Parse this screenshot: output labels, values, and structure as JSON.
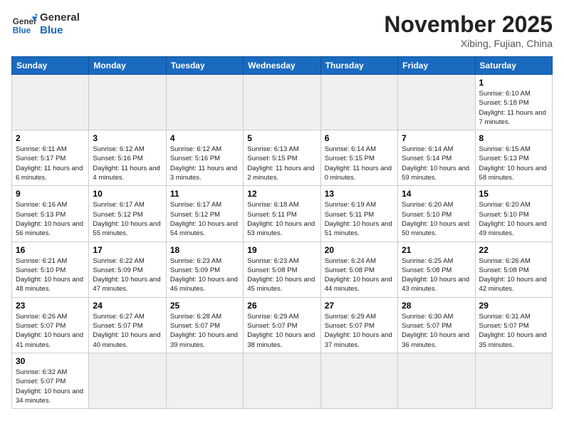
{
  "header": {
    "logo_general": "General",
    "logo_blue": "Blue",
    "month_title": "November 2025",
    "location": "Xibing, Fujian, China"
  },
  "weekdays": [
    "Sunday",
    "Monday",
    "Tuesday",
    "Wednesday",
    "Thursday",
    "Friday",
    "Saturday"
  ],
  "weeks": [
    [
      {
        "day": "",
        "empty": true
      },
      {
        "day": "",
        "empty": true
      },
      {
        "day": "",
        "empty": true
      },
      {
        "day": "",
        "empty": true
      },
      {
        "day": "",
        "empty": true
      },
      {
        "day": "",
        "empty": true
      },
      {
        "day": "1",
        "sunrise": "6:10 AM",
        "sunset": "5:18 PM",
        "daylight": "11 hours and 7 minutes."
      }
    ],
    [
      {
        "day": "2",
        "sunrise": "6:11 AM",
        "sunset": "5:17 PM",
        "daylight": "11 hours and 6 minutes."
      },
      {
        "day": "3",
        "sunrise": "6:12 AM",
        "sunset": "5:16 PM",
        "daylight": "11 hours and 4 minutes."
      },
      {
        "day": "4",
        "sunrise": "6:12 AM",
        "sunset": "5:16 PM",
        "daylight": "11 hours and 3 minutes."
      },
      {
        "day": "5",
        "sunrise": "6:13 AM",
        "sunset": "5:15 PM",
        "daylight": "11 hours and 2 minutes."
      },
      {
        "day": "6",
        "sunrise": "6:14 AM",
        "sunset": "5:15 PM",
        "daylight": "11 hours and 0 minutes."
      },
      {
        "day": "7",
        "sunrise": "6:14 AM",
        "sunset": "5:14 PM",
        "daylight": "10 hours and 59 minutes."
      },
      {
        "day": "8",
        "sunrise": "6:15 AM",
        "sunset": "5:13 PM",
        "daylight": "10 hours and 58 minutes."
      }
    ],
    [
      {
        "day": "9",
        "sunrise": "6:16 AM",
        "sunset": "5:13 PM",
        "daylight": "10 hours and 56 minutes."
      },
      {
        "day": "10",
        "sunrise": "6:17 AM",
        "sunset": "5:12 PM",
        "daylight": "10 hours and 55 minutes."
      },
      {
        "day": "11",
        "sunrise": "6:17 AM",
        "sunset": "5:12 PM",
        "daylight": "10 hours and 54 minutes."
      },
      {
        "day": "12",
        "sunrise": "6:18 AM",
        "sunset": "5:11 PM",
        "daylight": "10 hours and 53 minutes."
      },
      {
        "day": "13",
        "sunrise": "6:19 AM",
        "sunset": "5:11 PM",
        "daylight": "10 hours and 51 minutes."
      },
      {
        "day": "14",
        "sunrise": "6:20 AM",
        "sunset": "5:10 PM",
        "daylight": "10 hours and 50 minutes."
      },
      {
        "day": "15",
        "sunrise": "6:20 AM",
        "sunset": "5:10 PM",
        "daylight": "10 hours and 49 minutes."
      }
    ],
    [
      {
        "day": "16",
        "sunrise": "6:21 AM",
        "sunset": "5:10 PM",
        "daylight": "10 hours and 48 minutes."
      },
      {
        "day": "17",
        "sunrise": "6:22 AM",
        "sunset": "5:09 PM",
        "daylight": "10 hours and 47 minutes."
      },
      {
        "day": "18",
        "sunrise": "6:23 AM",
        "sunset": "5:09 PM",
        "daylight": "10 hours and 46 minutes."
      },
      {
        "day": "19",
        "sunrise": "6:23 AM",
        "sunset": "5:08 PM",
        "daylight": "10 hours and 45 minutes."
      },
      {
        "day": "20",
        "sunrise": "6:24 AM",
        "sunset": "5:08 PM",
        "daylight": "10 hours and 44 minutes."
      },
      {
        "day": "21",
        "sunrise": "6:25 AM",
        "sunset": "5:08 PM",
        "daylight": "10 hours and 43 minutes."
      },
      {
        "day": "22",
        "sunrise": "6:26 AM",
        "sunset": "5:08 PM",
        "daylight": "10 hours and 42 minutes."
      }
    ],
    [
      {
        "day": "23",
        "sunrise": "6:26 AM",
        "sunset": "5:07 PM",
        "daylight": "10 hours and 41 minutes."
      },
      {
        "day": "24",
        "sunrise": "6:27 AM",
        "sunset": "5:07 PM",
        "daylight": "10 hours and 40 minutes."
      },
      {
        "day": "25",
        "sunrise": "6:28 AM",
        "sunset": "5:07 PM",
        "daylight": "10 hours and 39 minutes."
      },
      {
        "day": "26",
        "sunrise": "6:29 AM",
        "sunset": "5:07 PM",
        "daylight": "10 hours and 38 minutes."
      },
      {
        "day": "27",
        "sunrise": "6:29 AM",
        "sunset": "5:07 PM",
        "daylight": "10 hours and 37 minutes."
      },
      {
        "day": "28",
        "sunrise": "6:30 AM",
        "sunset": "5:07 PM",
        "daylight": "10 hours and 36 minutes."
      },
      {
        "day": "29",
        "sunrise": "6:31 AM",
        "sunset": "5:07 PM",
        "daylight": "10 hours and 35 minutes."
      }
    ],
    [
      {
        "day": "30",
        "sunrise": "6:32 AM",
        "sunset": "5:07 PM",
        "daylight": "10 hours and 34 minutes."
      },
      {
        "day": "",
        "empty": true
      },
      {
        "day": "",
        "empty": true
      },
      {
        "day": "",
        "empty": true
      },
      {
        "day": "",
        "empty": true
      },
      {
        "day": "",
        "empty": true
      },
      {
        "day": "",
        "empty": true
      }
    ]
  ],
  "labels": {
    "sunrise": "Sunrise:",
    "sunset": "Sunset:",
    "daylight": "Daylight:"
  }
}
